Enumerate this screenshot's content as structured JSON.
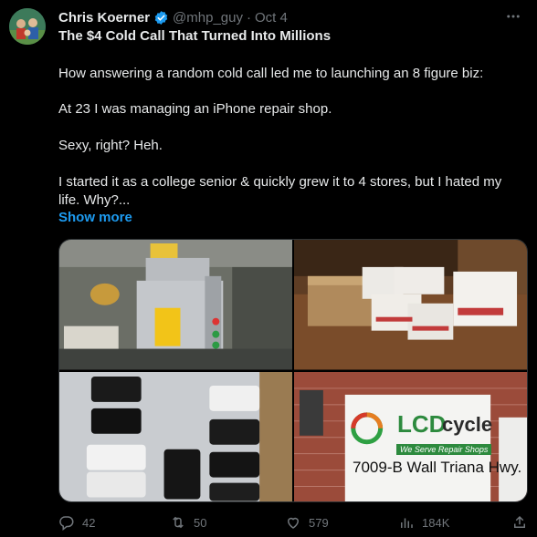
{
  "author": {
    "name": "Chris Koerner",
    "handle": "@mhp_guy",
    "date": "Oct 4",
    "dot": "·"
  },
  "colors": {
    "background": "#000000",
    "text": "#e7e9ea",
    "muted": "#71767b",
    "link": "#1d9bf0",
    "verified": "#1d9bf0"
  },
  "tweet": {
    "title": "The $4 Cold Call That Turned Into Millions",
    "paragraphs": [
      "How answering a random cold call led me to launching an 8 figure biz:",
      "At 23 I was managing an iPhone repair shop.",
      "Sexy, right? Heh.",
      "I started it as a college senior & quickly grew it to 4 stores, but I hated my life. Why?..."
    ],
    "show_more": "Show more"
  },
  "media": {
    "sign_brand_lcd": "LCD",
    "sign_brand_cycle": "cycle",
    "sign_tagline": "We Serve Repair Shops",
    "sign_address": "7009-B Wall Triana Hwy."
  },
  "stats": {
    "replies": "42",
    "reposts": "50",
    "likes": "579",
    "views": "184K"
  },
  "icons": [
    "verified-badge-icon",
    "more-icon",
    "reply-icon",
    "repost-icon",
    "like-icon",
    "views-icon",
    "share-icon"
  ]
}
